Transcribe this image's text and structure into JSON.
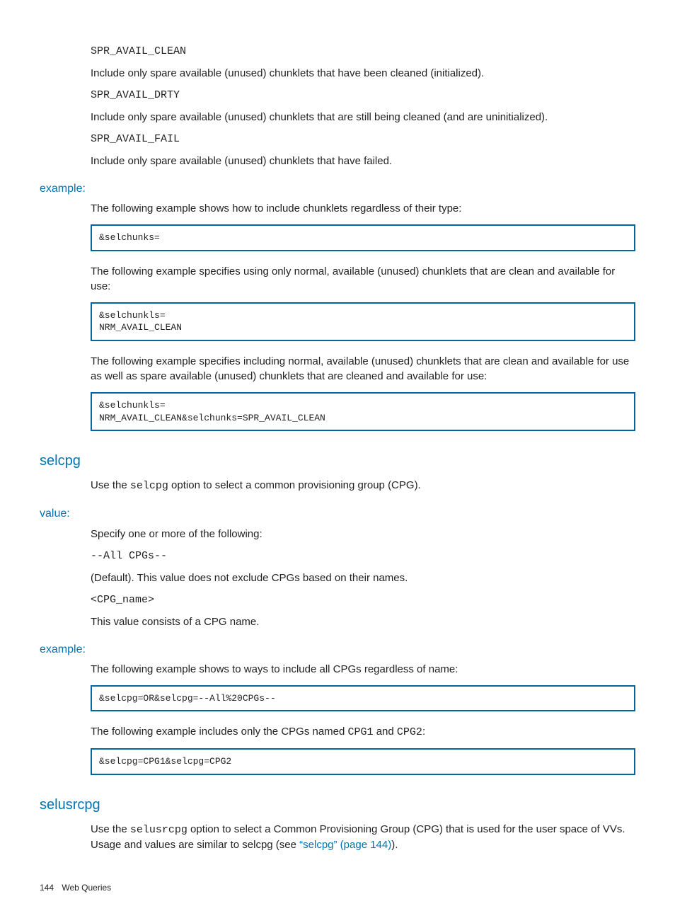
{
  "top": {
    "code1": "SPR_AVAIL_CLEAN",
    "desc1": "Include only spare available (unused) chunklets that have been cleaned (initialized).",
    "code2": "SPR_AVAIL_DRTY",
    "desc2": "Include only spare available (unused) chunklets that are still being cleaned (and are uninitialized).",
    "code3": "SPR_AVAIL_FAIL",
    "desc3": "Include only spare available (unused) chunklets that have failed."
  },
  "example1": {
    "heading": "example:",
    "p1": "The following example shows how to include chunklets regardless of their type:",
    "box1": "&selchunks=",
    "p2": "The following example specifies using only normal, available (unused) chunklets that are clean and available for use:",
    "box2": "&selchunkls=\nNRM_AVAIL_CLEAN",
    "p3": "The following example specifies including normal, available (unused) chunklets that are clean and available for use as well as spare available (unused) chunklets that are cleaned and available for use:",
    "box3": "&selchunkls=\nNRM_AVAIL_CLEAN&selchunks=SPR_AVAIL_CLEAN"
  },
  "selcpg": {
    "title": "selcpg",
    "p1a": "Use the ",
    "p1code": "selcpg",
    "p1b": " option to select a common provisioning group (CPG).",
    "value_heading": "value:",
    "v1": "Specify one or more of the following:",
    "v2": "--All CPGs--",
    "v3": "(Default). This value does not exclude CPGs based on their names.",
    "v4": "<CPG_name>",
    "v5": "This value consists of a CPG name.",
    "ex_heading": "example:",
    "ex_p1": "The following example shows to ways to include all CPGs regardless of name:",
    "ex_box1": "&selcpg=OR&selcpg=--All%20CPGs--",
    "ex_p2a": "The following example includes only the CPGs named ",
    "ex_p2_cpg1": "CPG1",
    "ex_p2_mid": " and ",
    "ex_p2_cpg2": "CPG2",
    "ex_p2_end": ":",
    "ex_box2": "&selcpg=CPG1&selcpg=CPG2"
  },
  "selusrcpg": {
    "title": "selusrcpg",
    "p1a": "Use the ",
    "p1code": "selusrcpg",
    "p1b": " option to select a Common Provisioning Group (CPG) that is used for the user space of VVs. Usage and values are similar to selcpg (see ",
    "link": "“selcpg” (page 144)",
    "p1c": ")."
  },
  "footer": {
    "page": "144",
    "label": "Web Queries"
  }
}
